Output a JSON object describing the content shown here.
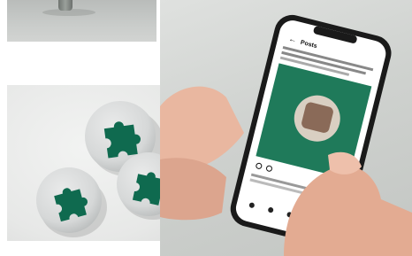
{
  "photos": {
    "top_left": {
      "icon": "street-pole-photo"
    },
    "buttons": {
      "icon": "puzzle-badge-buttons-photo",
      "badge_count": 3
    },
    "phone": {
      "icon": "hand-holding-phone-photo"
    }
  },
  "phone_screen": {
    "header_title": "Posts",
    "back_icon": "arrow-left-icon",
    "brand_color": "#1f7a5a",
    "badge_green": "#0d6b4e"
  }
}
